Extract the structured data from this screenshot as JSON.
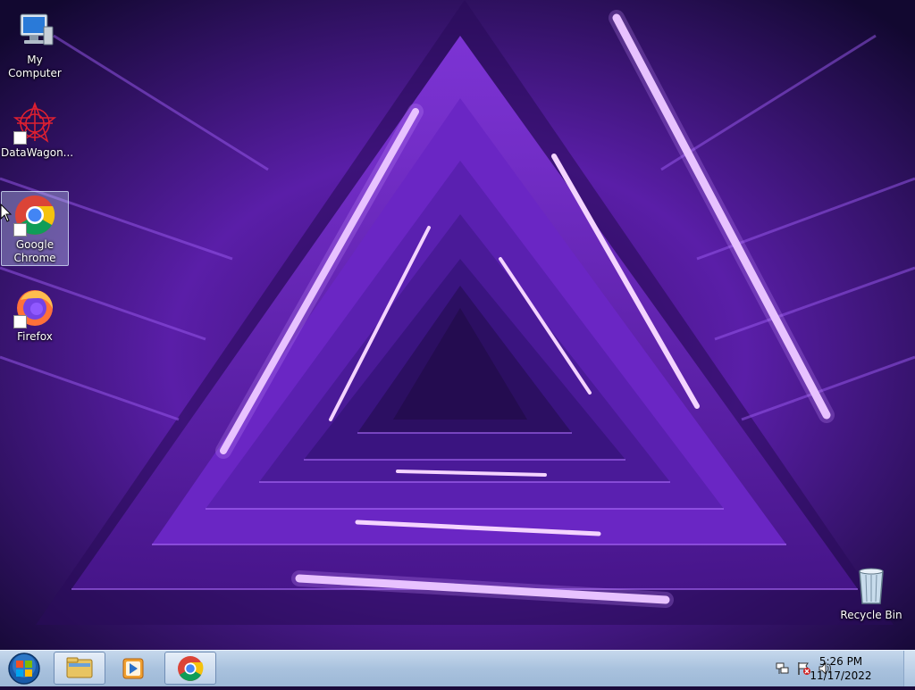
{
  "desktop": {
    "icons": [
      {
        "label": "My Computer"
      },
      {
        "label": "DataWagon..."
      },
      {
        "label": "Google\nChrome"
      },
      {
        "label": "Firefox"
      },
      {
        "label": "Recycle Bin"
      }
    ]
  },
  "taskbar": {
    "clock_time": "5:26 PM",
    "clock_date": "11/17/2022",
    "pinned": [
      "windows-explorer",
      "media-player",
      "google-chrome"
    ]
  },
  "colors": {
    "wallpaper_purple": "#7a2ed8",
    "neon_light": "#f0c8ff",
    "taskbar": "#b4cbe4"
  }
}
